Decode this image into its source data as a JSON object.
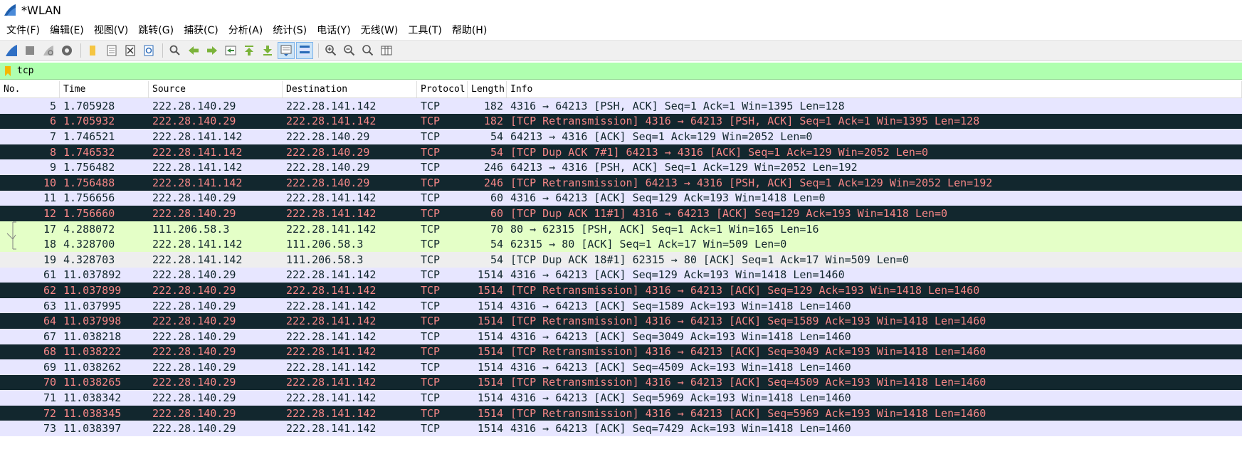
{
  "window": {
    "title": "*WLAN"
  },
  "menu": [
    "文件(F)",
    "编辑(E)",
    "视图(V)",
    "跳转(G)",
    "捕获(C)",
    "分析(A)",
    "统计(S)",
    "电话(Y)",
    "无线(W)",
    "工具(T)",
    "帮助(H)"
  ],
  "toolbar": {
    "icons": [
      "shark-fin-start-icon",
      "stop-square-icon",
      "restart-icon",
      "capture-options-gear-icon",
      "open-folder-icon",
      "save-file-icon",
      "close-file-icon",
      "reload-icon",
      "find-packet-icon",
      "go-back-arrow-icon",
      "go-forward-arrow-icon",
      "go-to-packet-icon",
      "go-first-icon",
      "go-last-icon",
      "autoscroll-icon",
      "colorize-icon",
      "zoom-in-icon",
      "zoom-out-icon",
      "zoom-normal-icon",
      "resize-columns-icon"
    ]
  },
  "filter": {
    "value": "tcp"
  },
  "columns": [
    "No.",
    "Time",
    "Source",
    "Destination",
    "Protocol",
    "Length",
    "Info"
  ],
  "packets": [
    {
      "no": "5",
      "time": "1.705928",
      "src": "222.28.140.29",
      "dst": "222.28.141.142",
      "proto": "TCP",
      "len": "182",
      "info": "4316 → 64213 [PSH, ACK] Seq=1 Ack=1 Win=1395 Len=128",
      "style": "normal"
    },
    {
      "no": "6",
      "time": "1.705932",
      "src": "222.28.140.29",
      "dst": "222.28.141.142",
      "proto": "TCP",
      "len": "182",
      "info": "[TCP Retransmission] 4316 → 64213 [PSH, ACK] Seq=1 Ack=1 Win=1395 Len=128",
      "style": "bad"
    },
    {
      "no": "7",
      "time": "1.746521",
      "src": "222.28.141.142",
      "dst": "222.28.140.29",
      "proto": "TCP",
      "len": "54",
      "info": "64213 → 4316 [ACK] Seq=1 Ack=129 Win=2052 Len=0",
      "style": "normal"
    },
    {
      "no": "8",
      "time": "1.746532",
      "src": "222.28.141.142",
      "dst": "222.28.140.29",
      "proto": "TCP",
      "len": "54",
      "info": "[TCP Dup ACK 7#1] 64213 → 4316 [ACK] Seq=1 Ack=129 Win=2052 Len=0",
      "style": "bad"
    },
    {
      "no": "9",
      "time": "1.756482",
      "src": "222.28.141.142",
      "dst": "222.28.140.29",
      "proto": "TCP",
      "len": "246",
      "info": "64213 → 4316 [PSH, ACK] Seq=1 Ack=129 Win=2052 Len=192",
      "style": "normal"
    },
    {
      "no": "10",
      "time": "1.756488",
      "src": "222.28.141.142",
      "dst": "222.28.140.29",
      "proto": "TCP",
      "len": "246",
      "info": "[TCP Retransmission] 64213 → 4316 [PSH, ACK] Seq=1 Ack=129 Win=2052 Len=192",
      "style": "bad"
    },
    {
      "no": "11",
      "time": "1.756656",
      "src": "222.28.140.29",
      "dst": "222.28.141.142",
      "proto": "TCP",
      "len": "60",
      "info": "4316 → 64213 [ACK] Seq=129 Ack=193 Win=1418 Len=0",
      "style": "normal"
    },
    {
      "no": "12",
      "time": "1.756660",
      "src": "222.28.140.29",
      "dst": "222.28.141.142",
      "proto": "TCP",
      "len": "60",
      "info": "[TCP Dup ACK 11#1] 4316 → 64213 [ACK] Seq=129 Ack=193 Win=1418 Len=0",
      "style": "bad"
    },
    {
      "no": "17",
      "time": "4.288072",
      "src": "111.206.58.3",
      "dst": "222.28.141.142",
      "proto": "TCP",
      "len": "70",
      "info": "80 → 62315 [PSH, ACK] Seq=1 Ack=1 Win=165 Len=16",
      "style": "http"
    },
    {
      "no": "18",
      "time": "4.328700",
      "src": "222.28.141.142",
      "dst": "111.206.58.3",
      "proto": "TCP",
      "len": "54",
      "info": "62315 → 80 [ACK] Seq=1 Ack=17 Win=509 Len=0",
      "style": "http"
    },
    {
      "no": "19",
      "time": "4.328703",
      "src": "222.28.141.142",
      "dst": "111.206.58.3",
      "proto": "TCP",
      "len": "54",
      "info": "[TCP Dup ACK 18#1] 62315 → 80 [ACK] Seq=1 Ack=17 Win=509 Len=0",
      "style": "grey"
    },
    {
      "no": "61",
      "time": "11.037892",
      "src": "222.28.140.29",
      "dst": "222.28.141.142",
      "proto": "TCP",
      "len": "1514",
      "info": "4316 → 64213 [ACK] Seq=129 Ack=193 Win=1418 Len=1460",
      "style": "normal"
    },
    {
      "no": "62",
      "time": "11.037899",
      "src": "222.28.140.29",
      "dst": "222.28.141.142",
      "proto": "TCP",
      "len": "1514",
      "info": "[TCP Retransmission] 4316 → 64213 [ACK] Seq=129 Ack=193 Win=1418 Len=1460",
      "style": "bad"
    },
    {
      "no": "63",
      "time": "11.037995",
      "src": "222.28.140.29",
      "dst": "222.28.141.142",
      "proto": "TCP",
      "len": "1514",
      "info": "4316 → 64213 [ACK] Seq=1589 Ack=193 Win=1418 Len=1460",
      "style": "normal"
    },
    {
      "no": "64",
      "time": "11.037998",
      "src": "222.28.140.29",
      "dst": "222.28.141.142",
      "proto": "TCP",
      "len": "1514",
      "info": "[TCP Retransmission] 4316 → 64213 [ACK] Seq=1589 Ack=193 Win=1418 Len=1460",
      "style": "bad"
    },
    {
      "no": "67",
      "time": "11.038218",
      "src": "222.28.140.29",
      "dst": "222.28.141.142",
      "proto": "TCP",
      "len": "1514",
      "info": "4316 → 64213 [ACK] Seq=3049 Ack=193 Win=1418 Len=1460",
      "style": "normal"
    },
    {
      "no": "68",
      "time": "11.038222",
      "src": "222.28.140.29",
      "dst": "222.28.141.142",
      "proto": "TCP",
      "len": "1514",
      "info": "[TCP Retransmission] 4316 → 64213 [ACK] Seq=3049 Ack=193 Win=1418 Len=1460",
      "style": "bad"
    },
    {
      "no": "69",
      "time": "11.038262",
      "src": "222.28.140.29",
      "dst": "222.28.141.142",
      "proto": "TCP",
      "len": "1514",
      "info": "4316 → 64213 [ACK] Seq=4509 Ack=193 Win=1418 Len=1460",
      "style": "normal"
    },
    {
      "no": "70",
      "time": "11.038265",
      "src": "222.28.140.29",
      "dst": "222.28.141.142",
      "proto": "TCP",
      "len": "1514",
      "info": "[TCP Retransmission] 4316 → 64213 [ACK] Seq=4509 Ack=193 Win=1418 Len=1460",
      "style": "bad"
    },
    {
      "no": "71",
      "time": "11.038342",
      "src": "222.28.140.29",
      "dst": "222.28.141.142",
      "proto": "TCP",
      "len": "1514",
      "info": "4316 → 64213 [ACK] Seq=5969 Ack=193 Win=1418 Len=1460",
      "style": "normal"
    },
    {
      "no": "72",
      "time": "11.038345",
      "src": "222.28.140.29",
      "dst": "222.28.141.142",
      "proto": "TCP",
      "len": "1514",
      "info": "[TCP Retransmission] 4316 → 64213 [ACK] Seq=5969 Ack=193 Win=1418 Len=1460",
      "style": "bad"
    },
    {
      "no": "73",
      "time": "11.038397",
      "src": "222.28.140.29",
      "dst": "222.28.141.142",
      "proto": "TCP",
      "len": "1514",
      "info": "4316 → 64213 [ACK] Seq=7429 Ack=193 Win=1418 Len=1460",
      "style": "normal"
    }
  ],
  "colors": {
    "normal_bg": "#e7e6ff",
    "bad_bg": "#12272e",
    "bad_fg": "#f78787",
    "http_bg": "#e4ffc7",
    "grey_bg": "#eeeeee",
    "filter_ok_bg": "#afffaf"
  }
}
